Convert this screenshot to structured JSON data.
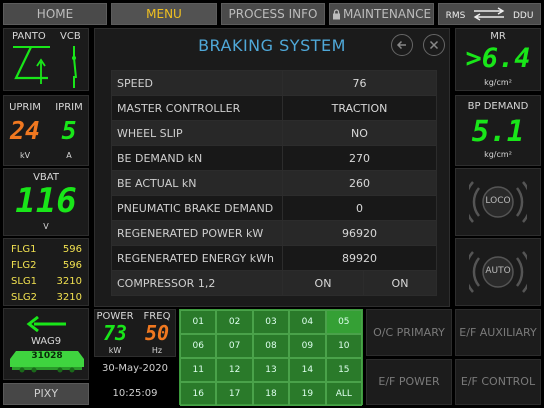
{
  "nav": {
    "home": "HOME",
    "menu": "MENU",
    "process_info": "PROCESS INFO",
    "maintenance": "MAINTENANCE",
    "rms": "RMS",
    "ddu": "DDU"
  },
  "left": {
    "panto": "PANTO",
    "vcb": "VCB",
    "uprim_label": "UPRIM",
    "uprim_value": "24",
    "uprim_unit": "kV",
    "iprim_label": "IPRIM",
    "iprim_value": "5",
    "iprim_unit": "A",
    "vbat_label": "VBAT",
    "vbat_value": "116",
    "vbat_unit": "V",
    "flags": [
      {
        "name": "FLG1",
        "value": "596"
      },
      {
        "name": "FLG2",
        "value": "596"
      },
      {
        "name": "SLG1",
        "value": "3210"
      },
      {
        "name": "SLG2",
        "value": "3210"
      }
    ],
    "loco_class": "WAG9",
    "loco_number": "31028",
    "pixy": "PIXY"
  },
  "main": {
    "title": "BRAKING SYSTEM",
    "rows": [
      {
        "label": "SPEED",
        "value": "76"
      },
      {
        "label": "MASTER CONTROLLER",
        "value": "TRACTION"
      },
      {
        "label": "WHEEL SLIP",
        "value": "NO"
      },
      {
        "label": "BE DEMAND kN",
        "value": "270"
      },
      {
        "label": "BE ACTUAL kN",
        "value": "260"
      },
      {
        "label": "PNEUMATIC BRAKE DEMAND",
        "value": "0"
      },
      {
        "label": "REGENERATED POWER kW",
        "value": "96920"
      },
      {
        "label": "REGENERATED ENERGY kWh",
        "value": "89920"
      }
    ],
    "compressor_label": "COMPRESSOR 1,2",
    "compressor_1": "ON",
    "compressor_2": "ON"
  },
  "right": {
    "mr_label": "MR",
    "mr_value": ">6.4",
    "mr_unit": "kg/cm²",
    "bp_label": "BP DEMAND",
    "bp_value": "5.1",
    "bp_unit": "kg/cm²",
    "loco_btn": "LOCO",
    "auto_btn": "AUTO"
  },
  "bottom": {
    "power_label": "POWER",
    "power_value": "73",
    "power_unit": "kW",
    "freq_label": "FREQ",
    "freq_value": "50",
    "freq_unit": "Hz",
    "date": "30-May-2020",
    "time": "10:25:09",
    "grid": [
      "01",
      "02",
      "03",
      "04",
      "05",
      "06",
      "07",
      "08",
      "09",
      "10",
      "11",
      "12",
      "13",
      "14",
      "15",
      "16",
      "17",
      "18",
      "19",
      "ALL"
    ],
    "oc_primary": "O/C PRIMARY",
    "ef_auxiliary": "E/F AUXILIARY",
    "ef_power": "E/F POWER",
    "ef_control": "E/F CONTROL"
  },
  "colors": {
    "accent_green": "#19e619",
    "accent_orange": "#f07820",
    "menu_active": "#f0c020",
    "title_blue": "#4fa8d8",
    "flag_yellow": "#f0e050",
    "grid_green": "#2a7a2a"
  }
}
